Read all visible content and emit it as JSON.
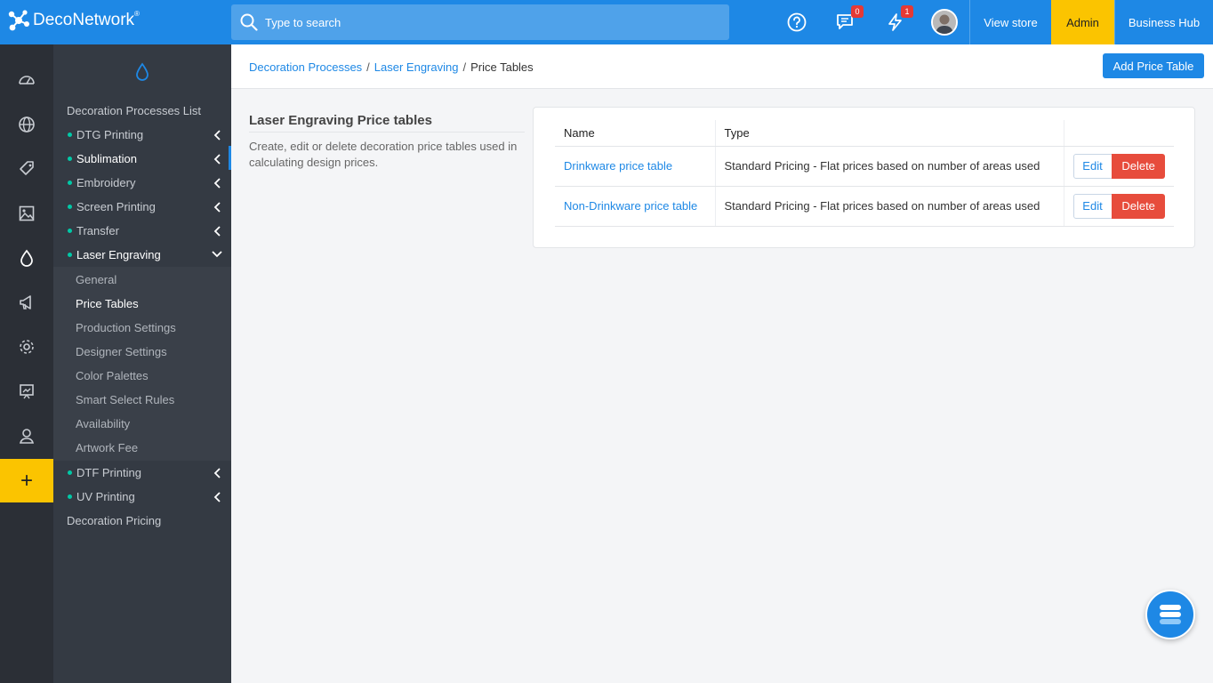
{
  "app": {
    "logo_text": "DecoNetwork",
    "logo_mark": "®"
  },
  "search": {
    "placeholder": "Type to search"
  },
  "topbar": {
    "messages_badge": "0",
    "alerts_badge": "1",
    "view_store": "View store",
    "admin": "Admin",
    "business_hub": "Business Hub",
    "icons": [
      "help-icon",
      "messages-icon",
      "lightning-icon",
      "avatar"
    ]
  },
  "rail": {
    "icons": [
      "dashboard-icon",
      "globe-icon",
      "tag-icon",
      "image-icon",
      "drop-icon",
      "megaphone-icon",
      "gear-icon",
      "presentation-icon",
      "user-icon"
    ],
    "plus": "+"
  },
  "sidebar": {
    "header_icon": "drop-icon",
    "list_title": "Decoration Processes List",
    "items": [
      {
        "label": "DTG Printing"
      },
      {
        "label": "Sublimation"
      },
      {
        "label": "Embroidery"
      },
      {
        "label": "Screen Printing"
      },
      {
        "label": "Transfer"
      },
      {
        "label": "Laser Engraving"
      }
    ],
    "subitems": [
      {
        "label": "General"
      },
      {
        "label": "Price Tables"
      },
      {
        "label": "Production Settings"
      },
      {
        "label": "Designer Settings"
      },
      {
        "label": "Color Palettes"
      },
      {
        "label": "Smart Select Rules"
      },
      {
        "label": "Availability"
      },
      {
        "label": "Artwork Fee"
      }
    ],
    "items_after": [
      {
        "label": "DTF Printing"
      },
      {
        "label": "UV Printing"
      }
    ],
    "footer": "Decoration Pricing"
  },
  "breadcrumb": {
    "items": [
      "Decoration Processes",
      "Laser Engraving",
      "Price Tables"
    ],
    "separator": "/"
  },
  "actions": {
    "add_price_table": "Add Price Table"
  },
  "section": {
    "title": "Laser Engraving Price tables",
    "description": "Create, edit or delete decoration price tables used in calculating design prices."
  },
  "table": {
    "headers": [
      "Name",
      "Type"
    ],
    "rows": [
      {
        "name": "Drinkware price table",
        "type": "Standard Pricing - Flat prices based on number of areas used"
      },
      {
        "name": "Non-Drinkware price table",
        "type": "Standard Pricing - Flat prices based on number of areas used"
      }
    ],
    "edit_label": "Edit",
    "delete_label": "Delete"
  },
  "colors": {
    "primary": "#1e88e5",
    "accent": "#fbc400",
    "danger": "#e74c3c",
    "sidebar": "#343a43",
    "rail": "#2b2f36",
    "status_dot": "#00c9a7"
  }
}
